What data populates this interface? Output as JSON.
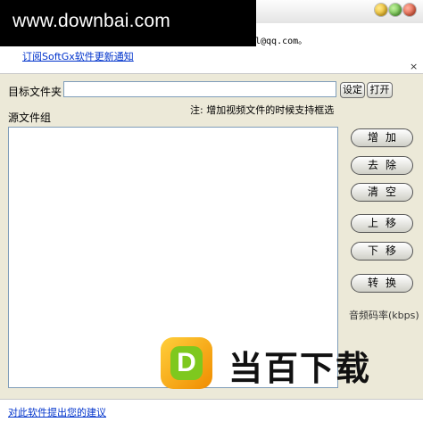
{
  "watermark": {
    "site": "www.downbai.com"
  },
  "header": {
    "email_fragment": "l@qq.com。",
    "subscribe_link": "订阅SoftGx软件更新通知",
    "close_glyph": "×"
  },
  "form": {
    "target_folder_label": "目标文件夹",
    "target_folder_value": "",
    "set_button": "设定",
    "open_button": "打开",
    "hint": "注: 增加视频文件的时候支持框选",
    "source_group_label": "源文件组"
  },
  "side_buttons": {
    "add": "增加",
    "remove": "去除",
    "clear": "清空",
    "move_up": "上移",
    "move_down": "下移",
    "convert": "转换"
  },
  "partial_text": "音频码率(kbps)",
  "logo": {
    "letter": "D",
    "text": "当百下载"
  },
  "footer": {
    "feedback_link": "对此软件提出您的建议"
  },
  "icons": [
    "minimize-icon",
    "maximize-icon",
    "close-icon"
  ]
}
